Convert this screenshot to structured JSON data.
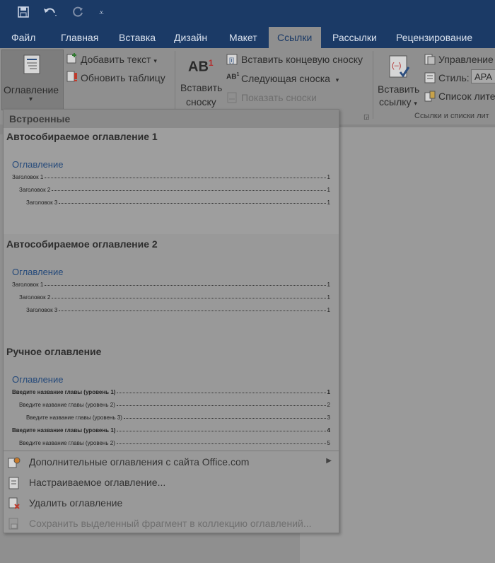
{
  "qat": {
    "save_icon": "save-icon",
    "undo_icon": "undo-icon",
    "redo_icon": "redo-icon",
    "customize_icon": "customize-qat-icon"
  },
  "tabs": [
    {
      "label": "Файл"
    },
    {
      "label": "Главная"
    },
    {
      "label": "Вставка"
    },
    {
      "label": "Дизайн"
    },
    {
      "label": "Макет"
    },
    {
      "label": "Ссылки",
      "active": true
    },
    {
      "label": "Рассылки"
    },
    {
      "label": "Рецензирование"
    }
  ],
  "ribbon": {
    "toc_button": "Оглавление",
    "add_text": "Добавить текст",
    "update_table": "Обновить таблицу",
    "insert_footnote_line1": "Вставить",
    "insert_footnote_line2": "сноску",
    "insert_endnote": "Вставить концевую сноску",
    "next_footnote": "Следующая сноска",
    "show_notes": "Показать сноски",
    "insert_citation_line1": "Вставить",
    "insert_citation_line2": "ссылку",
    "manage_sources": "Управление",
    "style_label": "Стиль:",
    "style_value": "APA",
    "bibliography": "Список лите",
    "group_citations": "Ссылки и списки лит"
  },
  "dropdown": {
    "header": "Встроенные",
    "entries": [
      {
        "title": "Автособираемое оглавление 1",
        "preview_heading": "Оглавление",
        "lines": [
          {
            "label": "Заголовок 1",
            "page": "1"
          },
          {
            "label": "Заголовок 2",
            "page": "1"
          },
          {
            "label": "Заголовок 3",
            "page": "1"
          }
        ]
      },
      {
        "title": "Автособираемое оглавление 2",
        "preview_heading": "Оглавление",
        "lines": [
          {
            "label": "Заголовок 1",
            "page": "1"
          },
          {
            "label": "Заголовок 2",
            "page": "1"
          },
          {
            "label": "Заголовок 3",
            "page": "1"
          }
        ]
      },
      {
        "title": "Ручное оглавление",
        "preview_heading": "Оглавление",
        "lines": [
          {
            "label": "Введите название главы (уровень 1)",
            "page": "1"
          },
          {
            "label": "Введите название главы (уровень 2)",
            "page": "2"
          },
          {
            "label": "Введите название главы (уровень 3)",
            "page": "3"
          },
          {
            "label": "Введите название главы (уровень 1)",
            "page": "4"
          },
          {
            "label": "Введите название главы (уровень 2)",
            "page": "5"
          }
        ]
      }
    ],
    "menu": [
      {
        "label": "Дополнительные оглавления с сайта Office.com",
        "icon": "office-toc-icon"
      },
      {
        "label": "Настраиваемое оглавление...",
        "icon": "custom-toc-icon"
      },
      {
        "label": "Удалить оглавление",
        "icon": "remove-toc-icon"
      },
      {
        "label": "Сохранить выделенный фрагмент в коллекцию оглавлений...",
        "icon": "save-selection-icon",
        "disabled": true
      }
    ]
  }
}
